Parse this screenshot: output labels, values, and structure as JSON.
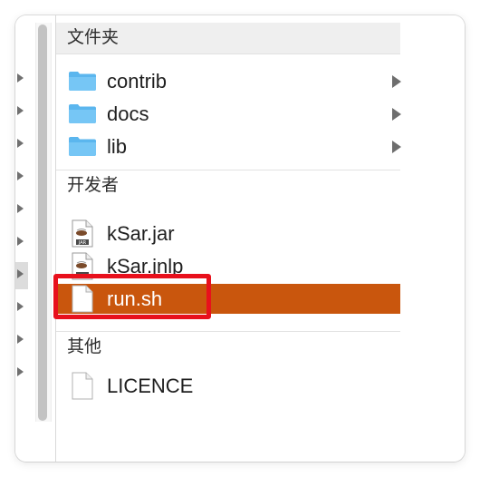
{
  "sections": {
    "folders_header": "文件夹",
    "developer_header": "开发者",
    "other_header": "其他"
  },
  "folders": [
    {
      "label": "contrib",
      "icon": "folder-icon",
      "has_children": true
    },
    {
      "label": "docs",
      "icon": "folder-icon",
      "has_children": true
    },
    {
      "label": "lib",
      "icon": "folder-icon",
      "has_children": true
    }
  ],
  "developer_files": [
    {
      "label": "kSar.jar",
      "icon": "jar-file-icon"
    },
    {
      "label": "kSar.jnlp",
      "icon": "jnlp-file-icon"
    },
    {
      "label": "run.sh",
      "icon": "document-icon",
      "selected": true
    }
  ],
  "other_files": [
    {
      "label": "LICENCE",
      "icon": "document-icon"
    }
  ],
  "colors": {
    "selection": "#c9560d",
    "highlight_box": "#e8101c",
    "folder_blue": "#5bb6ee"
  }
}
